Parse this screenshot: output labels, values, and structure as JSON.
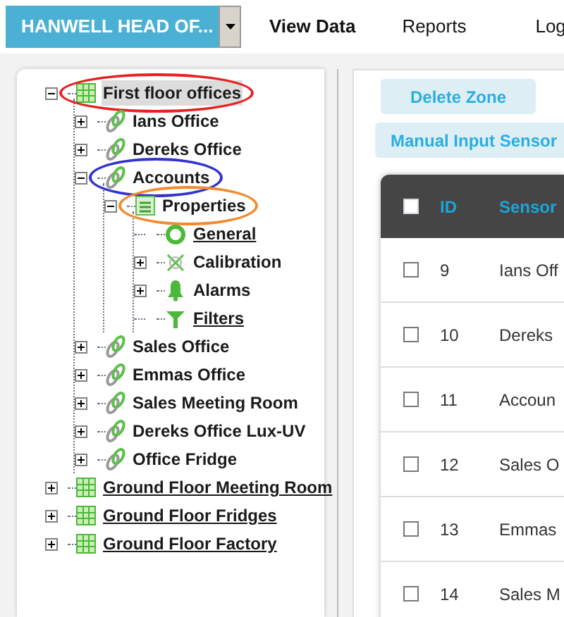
{
  "header": {
    "site": "HANWELL HEAD OF...",
    "nav": [
      {
        "label": "View Data",
        "selected": true
      },
      {
        "label": "Reports",
        "selected": false
      },
      {
        "label": "Log",
        "selected": false
      }
    ]
  },
  "tree": [
    {
      "label": "First floor offices",
      "kind": "zone",
      "expanded": true,
      "selected": true,
      "link": false,
      "color": "#e52222",
      "children": [
        {
          "label": "Ians Office",
          "kind": "sensor",
          "expanded": false,
          "selected": false,
          "link": false
        },
        {
          "label": "Dereks Office",
          "kind": "sensor",
          "expanded": false,
          "selected": false,
          "link": false
        },
        {
          "label": "Accounts",
          "kind": "sensor",
          "expanded": true,
          "selected": false,
          "link": false,
          "color": "#3333cc",
          "children": [
            {
              "label": "Properties",
              "kind": "properties",
              "expanded": true,
              "selected": false,
              "link": false,
              "color": "#f28a2e",
              "children": [
                {
                  "label": "General",
                  "kind": "general",
                  "selected": false,
                  "link": true
                },
                {
                  "label": "Calibration",
                  "kind": "calibration",
                  "expanded": false,
                  "selected": false,
                  "link": false
                },
                {
                  "label": "Alarms",
                  "kind": "alarms",
                  "expanded": false,
                  "selected": false,
                  "link": false
                },
                {
                  "label": "Filters",
                  "kind": "filters",
                  "selected": false,
                  "link": true
                }
              ]
            }
          ]
        },
        {
          "label": "Sales Office",
          "kind": "sensor",
          "expanded": false,
          "selected": false,
          "link": false
        },
        {
          "label": "Emmas Office",
          "kind": "sensor",
          "expanded": false,
          "selected": false,
          "link": false
        },
        {
          "label": "Sales Meeting Room",
          "kind": "sensor",
          "expanded": false,
          "selected": false,
          "link": false
        },
        {
          "label": "Dereks Office Lux-UV",
          "kind": "sensor",
          "expanded": false,
          "selected": false,
          "link": false
        },
        {
          "label": "Office Fridge",
          "kind": "sensor",
          "expanded": false,
          "selected": false,
          "link": false
        }
      ]
    },
    {
      "label": "Ground Floor Meeting Room",
      "kind": "zone",
      "expanded": false,
      "selected": false,
      "link": true
    },
    {
      "label": "Ground Floor Fridges",
      "kind": "zone",
      "expanded": false,
      "selected": false,
      "link": true
    },
    {
      "label": "Ground Floor Factory",
      "kind": "zone",
      "expanded": false,
      "selected": false,
      "link": true
    }
  ],
  "buttons": [
    {
      "label": "Delete Zone"
    },
    {
      "label": "Manual Input Sensor"
    }
  ],
  "table": {
    "header_checked": false,
    "columns": [
      "ID",
      "Sensor"
    ],
    "rows": [
      {
        "checked": false,
        "id": "9",
        "sensor": "Ians Off"
      },
      {
        "checked": false,
        "id": "10",
        "sensor": "Dereks"
      },
      {
        "checked": false,
        "id": "11",
        "sensor": "Accoun"
      },
      {
        "checked": false,
        "id": "12",
        "sensor": "Sales O"
      },
      {
        "checked": false,
        "id": "13",
        "sensor": "Emmas"
      },
      {
        "checked": false,
        "id": "14",
        "sensor": "Sales M"
      }
    ]
  }
}
